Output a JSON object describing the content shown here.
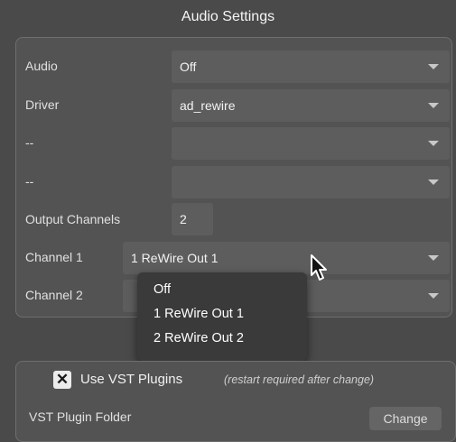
{
  "window": {
    "title": "Audio Settings"
  },
  "rows": [
    {
      "label": "Audio",
      "value": "Off"
    },
    {
      "label": "Driver",
      "value": "ad_rewire"
    },
    {
      "label": "--",
      "value": ""
    },
    {
      "label": "--",
      "value": ""
    }
  ],
  "output_channels": {
    "label": "Output Channels",
    "value": "2"
  },
  "channel1": {
    "label": "Channel 1",
    "value": "1 ReWire Out 1"
  },
  "channel2": {
    "label": "Channel 2",
    "value": ""
  },
  "dropdown": {
    "options": [
      "Off",
      "1 ReWire Out 1",
      "2 ReWire Out 2"
    ]
  },
  "vst": {
    "checkbox_mark": "✕",
    "label": "Use VST Plugins",
    "hint": "(restart required after change)",
    "checked": true,
    "folder_label": "VST Plugin Folder",
    "change_button": "Change"
  },
  "colors": {
    "background": "#4a4a4a",
    "panel": "#535353",
    "field": "#5d5d5d",
    "menu": "#3a3a3a"
  },
  "icons": {
    "dropdown_arrow": "chevron-down-icon",
    "cursor": "mouse-pointer-icon"
  }
}
